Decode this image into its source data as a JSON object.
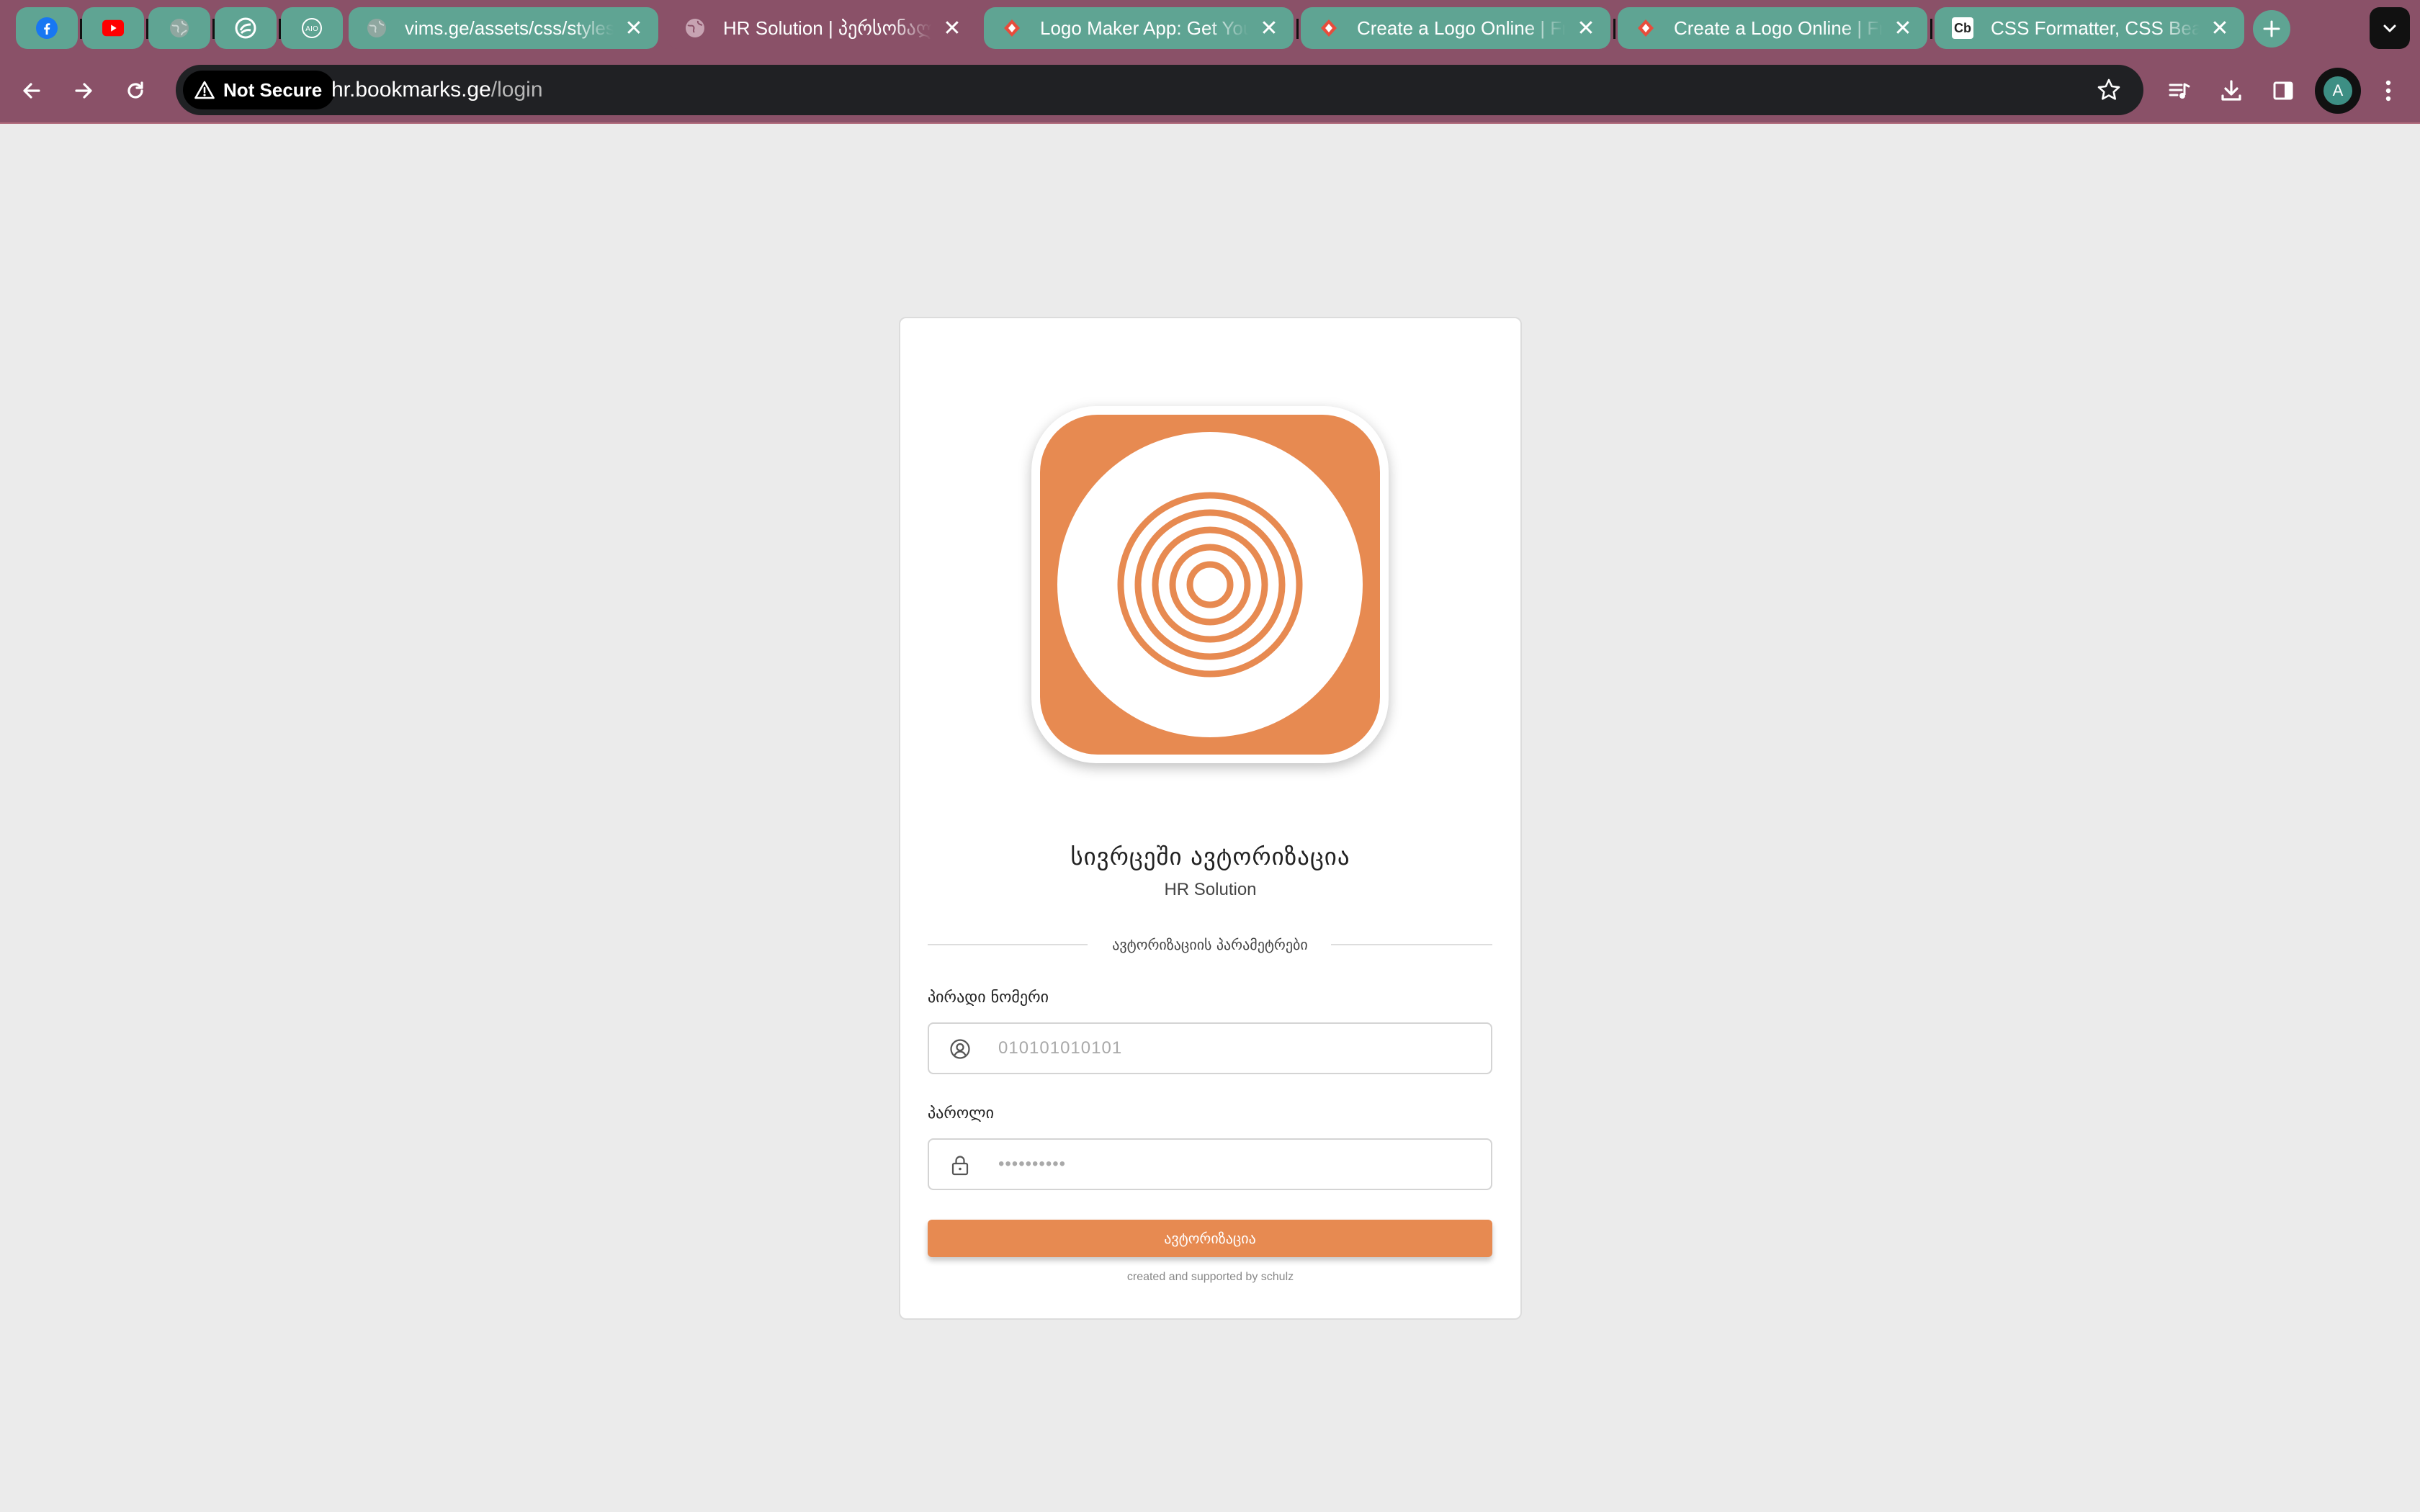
{
  "browser": {
    "tabs": [
      {
        "id": "facebook",
        "title": "",
        "pinned": true,
        "icon": "facebook-icon"
      },
      {
        "id": "youtube",
        "title": "",
        "pinned": true,
        "icon": "youtube-icon"
      },
      {
        "id": "globe",
        "title": "",
        "pinned": true,
        "icon": "globe-icon"
      },
      {
        "id": "app",
        "title": "",
        "pinned": true,
        "icon": "app-icon"
      },
      {
        "id": "round",
        "title": "",
        "pinned": true,
        "icon": "round-logo-icon"
      },
      {
        "id": "vims",
        "title": "vims.ge/assets/css/styles.css",
        "pinned": false,
        "icon": "globe-icon"
      },
      {
        "id": "hr",
        "title": "HR Solution | პერსონალის",
        "pinned": false,
        "icon": "globe-icon",
        "active": true
      },
      {
        "id": "logomaker",
        "title": "Logo Maker App: Get Your",
        "pinned": false,
        "icon": "logo-maker-icon"
      },
      {
        "id": "createlogo1",
        "title": "Create a Logo Online | Free",
        "pinned": false,
        "icon": "logo-maker-icon"
      },
      {
        "id": "createlogo2",
        "title": "Create a Logo Online | Free",
        "pinned": false,
        "icon": "logo-maker-icon"
      },
      {
        "id": "cssformatter",
        "title": "CSS Formatter, CSS Beautifier",
        "pinned": false,
        "icon": "cb-icon",
        "favicon_text": "Cb"
      }
    ],
    "security_label": "Not Secure",
    "url_host": "hr.bookmarks.ge",
    "url_path": "/login",
    "profile_initial": "A"
  },
  "login": {
    "title": "სივრცეში ავტორიზაცია",
    "subtitle": "HR Solution",
    "divider_text": "ავტორიზაციის პარამეტრები",
    "id_label": "პირადი ნომერი",
    "id_placeholder": "010101010101",
    "password_label": "პაროლი",
    "password_placeholder": "••••••••••",
    "submit_label": "ავტორიზაცია",
    "footer": "created and supported by schulz"
  },
  "colors": {
    "accent": "#e78a51",
    "tab_bar": "#8a5168",
    "tab_group": "#5fa493",
    "page_bg": "#ebebeb"
  }
}
